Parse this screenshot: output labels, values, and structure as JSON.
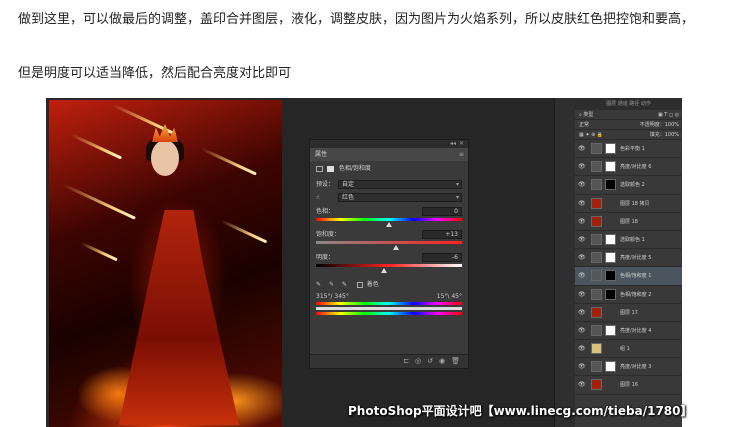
{
  "article": {
    "paragraph1": "做到这里，可以做最后的调整，盖印合并图层，液化，调整皮肤，因为图片为火焰系列，所以皮肤红色把控饱和要高，",
    "paragraph2": "但是明度可以适当降低，然后配合亮度对比即可"
  },
  "properties": {
    "panel_title": "属性",
    "tab_label": "色相/饱和度",
    "preset_label": "预设：",
    "preset_value": "自定",
    "channel_value": "红色",
    "hue_label": "色相：",
    "hue_value": "0",
    "saturation_label": "饱和度：",
    "saturation_value": "+13",
    "lightness_label": "明度：",
    "lightness_value": "-6",
    "colorize_label": "着色",
    "range_left": "315°/ 345°",
    "range_right": "15°\\ 45°"
  },
  "layers": {
    "header": "图层  通道  路径  动作",
    "blend_mode": "正常",
    "opacity_label": "不透明度：",
    "opacity_value": "100%",
    "fill_label": "填充：",
    "fill_value": "100%",
    "kind_label": "类型",
    "items": [
      {
        "name": "色彩平衡 1",
        "selected": false
      },
      {
        "name": "亮度/对比度 6",
        "selected": false
      },
      {
        "name": "选取颜色 2",
        "selected": false
      },
      {
        "name": "图层 18 拷贝",
        "selected": false
      },
      {
        "name": "图层 18",
        "selected": false
      },
      {
        "name": "选取颜色 1",
        "selected": false
      },
      {
        "name": "亮度/对比度 5",
        "selected": false
      },
      {
        "name": "色相/饱和度 1",
        "selected": true
      },
      {
        "name": "色相/饱和度 2",
        "selected": false
      },
      {
        "name": "图层 17",
        "selected": false
      },
      {
        "name": "亮度/对比度 4",
        "selected": false
      },
      {
        "name": "组 1",
        "selected": false
      },
      {
        "name": "亮度/对比度 3",
        "selected": false
      },
      {
        "name": "图层 16",
        "selected": false
      }
    ]
  },
  "watermark": "PhotoShop平面设计吧【www.linecg.com/tieba/1780】",
  "colors": {
    "canvas_bg": "#262626",
    "panel_bg": "#3a3a3a",
    "selected_layer": "#4a5560"
  }
}
